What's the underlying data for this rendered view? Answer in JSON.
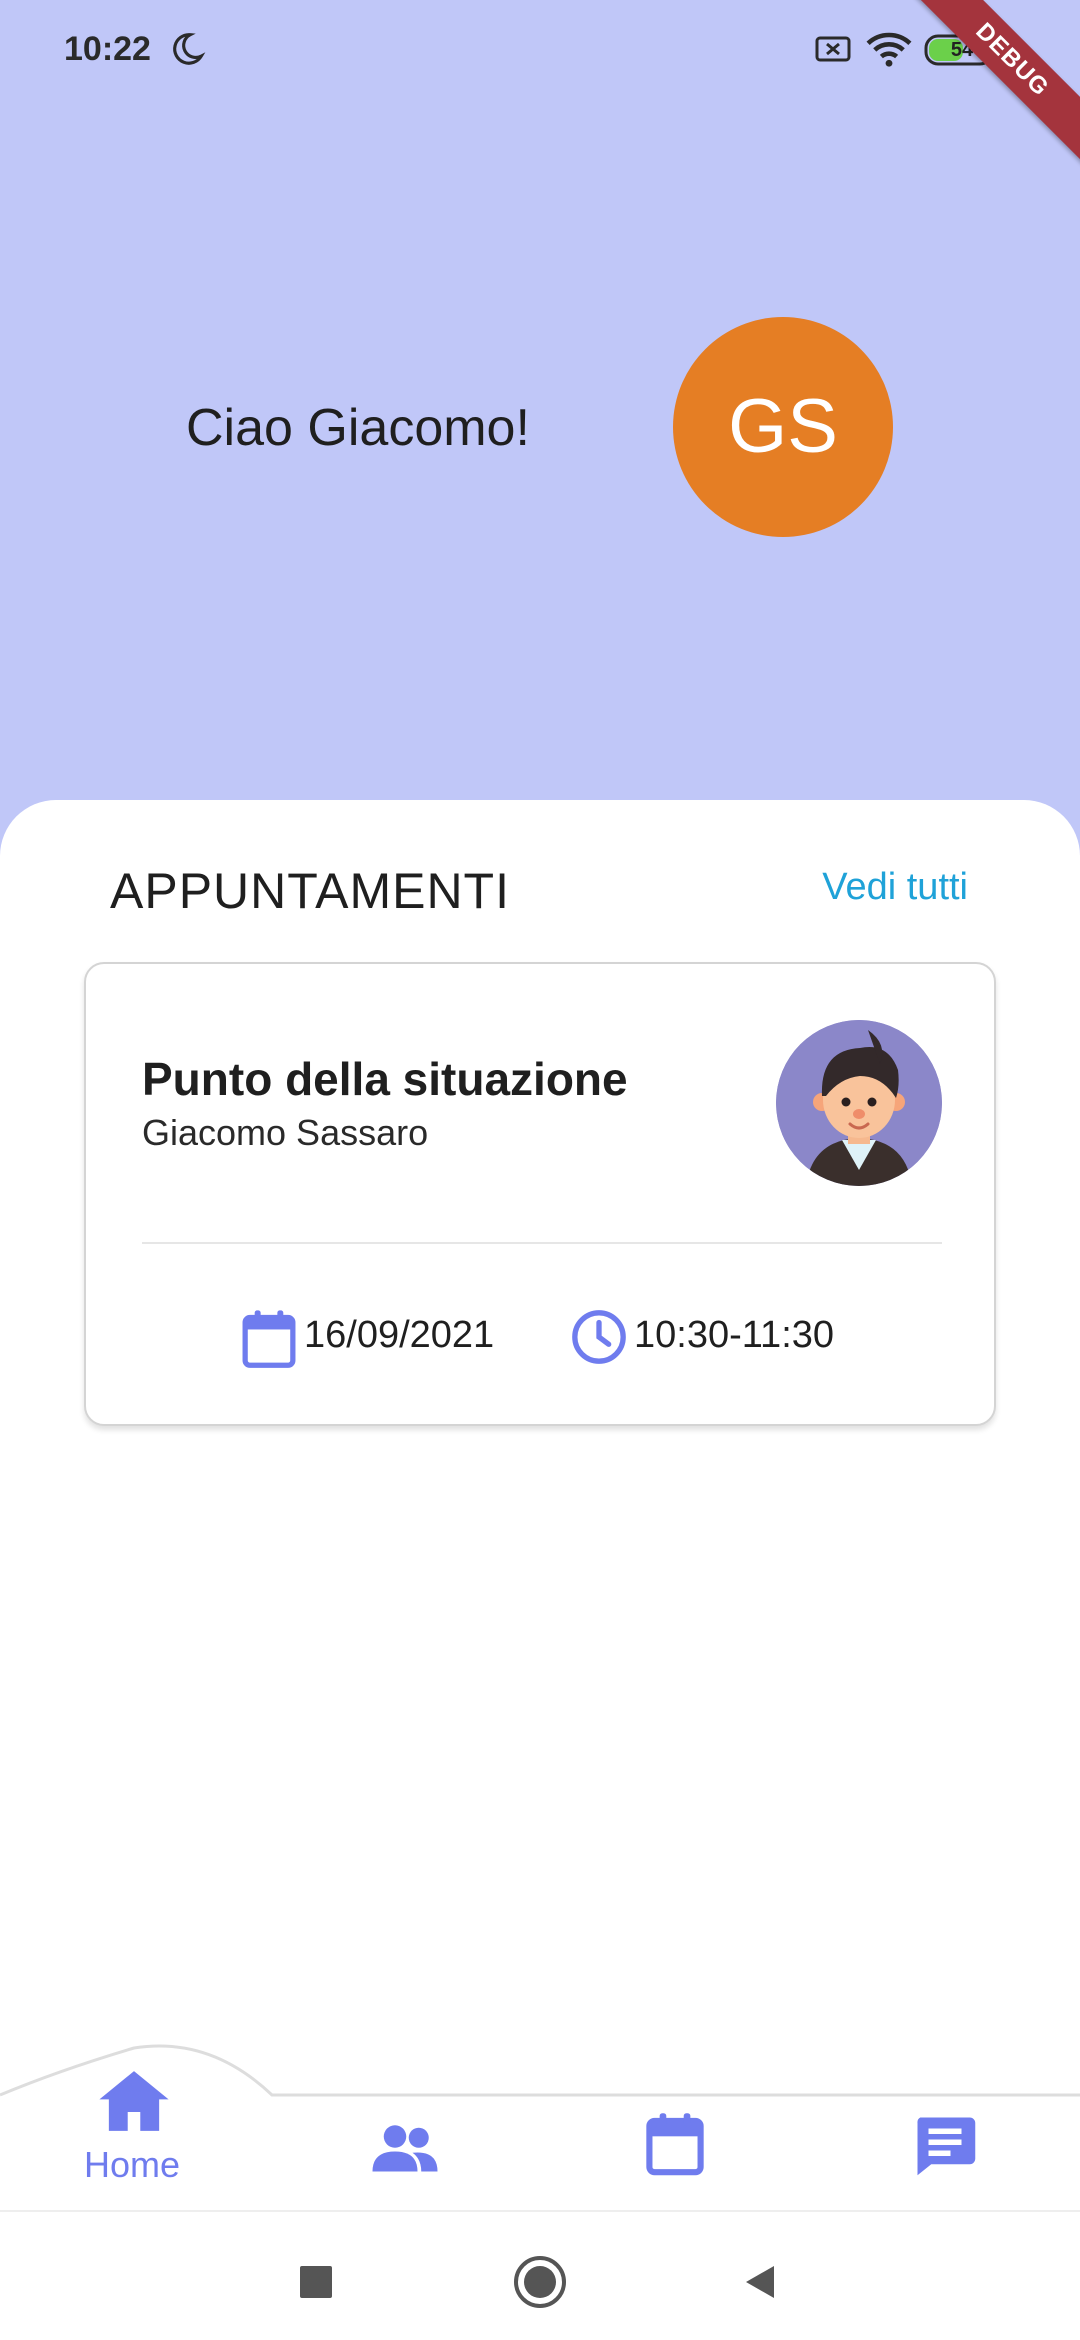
{
  "status_bar": {
    "time": "10:22",
    "battery_level": "54",
    "icons": [
      "moon-icon",
      "battery-saver-x-icon",
      "wifi-icon",
      "battery-icon"
    ]
  },
  "debug_banner": "DEBUG",
  "header": {
    "greeting": "Ciao Giacomo!",
    "avatar_initials": "GS",
    "background_color": "#c0c7f8",
    "avatar_color": "#e57e24"
  },
  "appointments": {
    "section_title": "APPUNTAMENTI",
    "see_all_label": "Vedi tutti",
    "items": [
      {
        "title": "Punto della situazione",
        "person": "Giacomo Sassaro",
        "date": "16/09/2021",
        "time": "10:30-11:30"
      }
    ]
  },
  "bottom_nav": {
    "accent_color": "#6f7cee",
    "items": [
      {
        "label": "Home",
        "icon": "home-icon",
        "active": true
      },
      {
        "label": "",
        "icon": "people-icon",
        "active": false
      },
      {
        "label": "",
        "icon": "calendar-icon",
        "active": false
      },
      {
        "label": "",
        "icon": "chat-icon",
        "active": false
      }
    ]
  },
  "system_nav": {
    "icons": [
      "recents-square-icon",
      "home-circle-icon",
      "back-triangle-icon"
    ]
  }
}
